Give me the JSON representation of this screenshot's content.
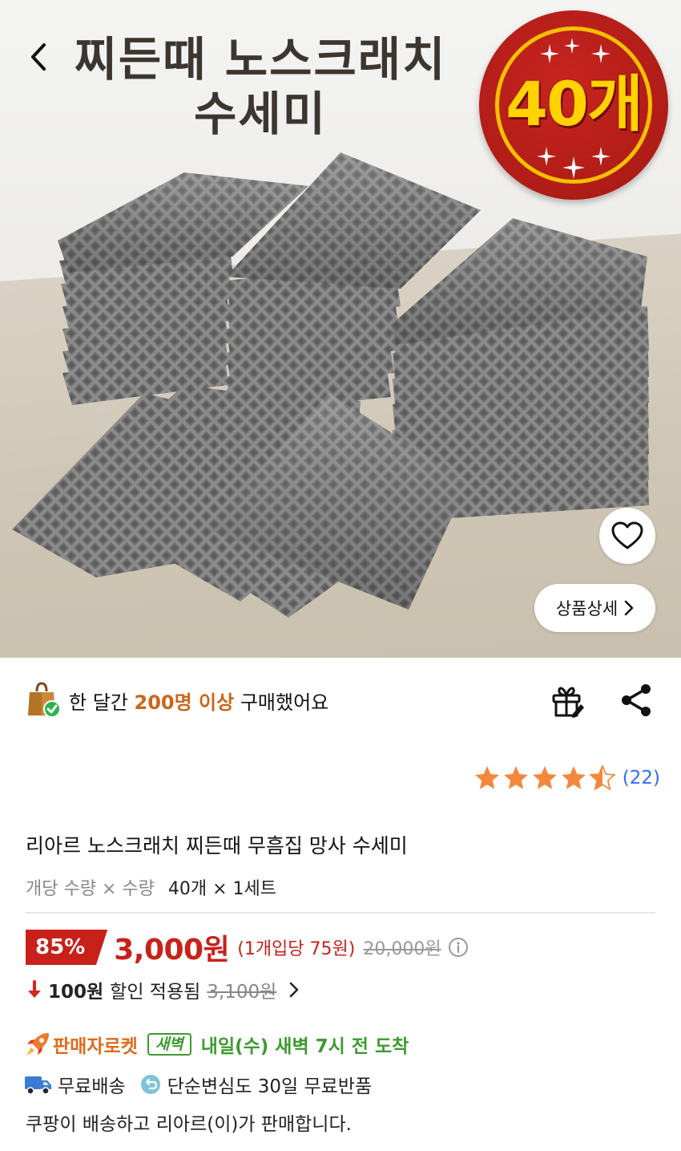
{
  "hero": {
    "headline_line1": "찌든때 노스크래치",
    "headline_line2": "수세미",
    "badge_text": "40개",
    "detail_button_label": "상품상세"
  },
  "purchase_info": {
    "prefix": "한 달간 ",
    "highlight": "200명 이상",
    "suffix": " 구매했어요"
  },
  "rating": {
    "stars": 4.5,
    "review_count": "(22)"
  },
  "product": {
    "title": "리아르 노스크래치 찌든때 무흠집 망사 수세미",
    "option_label": "개당 수량 × 수량",
    "option_value": "40개 × 1세트"
  },
  "price": {
    "discount_rate": "85%",
    "sale_price": "3,000원",
    "unit_price": "(1개입당 75원)",
    "original_price": "20,000원"
  },
  "coupon": {
    "amount": "100원",
    "text": "할인 적용됨",
    "before_price": "3,100원"
  },
  "delivery": {
    "seller_rocket": "판매자로켓",
    "dawn_badge": "새벽",
    "arrival": "내일(수) 새벽 7시 전 도착"
  },
  "shipping": {
    "free_shipping": "무료배송",
    "free_return": "단순변심도 30일 무료반품"
  },
  "seller_notice": "쿠팡이 배송하고 리아르(이)가 판매합니다.",
  "colors": {
    "accent_red": "#c8211a",
    "rating_blue": "#346aff",
    "rocket_orange": "#e06a1b",
    "dawn_green": "#3d9a2f",
    "purchase_orange": "#c9661c",
    "star_orange": "#f5873c"
  },
  "icons": {
    "back": "chevron-left-icon",
    "heart": "heart-icon",
    "gift": "gift-icon",
    "share": "share-icon",
    "info": "info-icon",
    "truck": "truck-icon",
    "return": "return-icon",
    "rocket": "rocket-icon",
    "bag": "shopping-bag-icon"
  }
}
